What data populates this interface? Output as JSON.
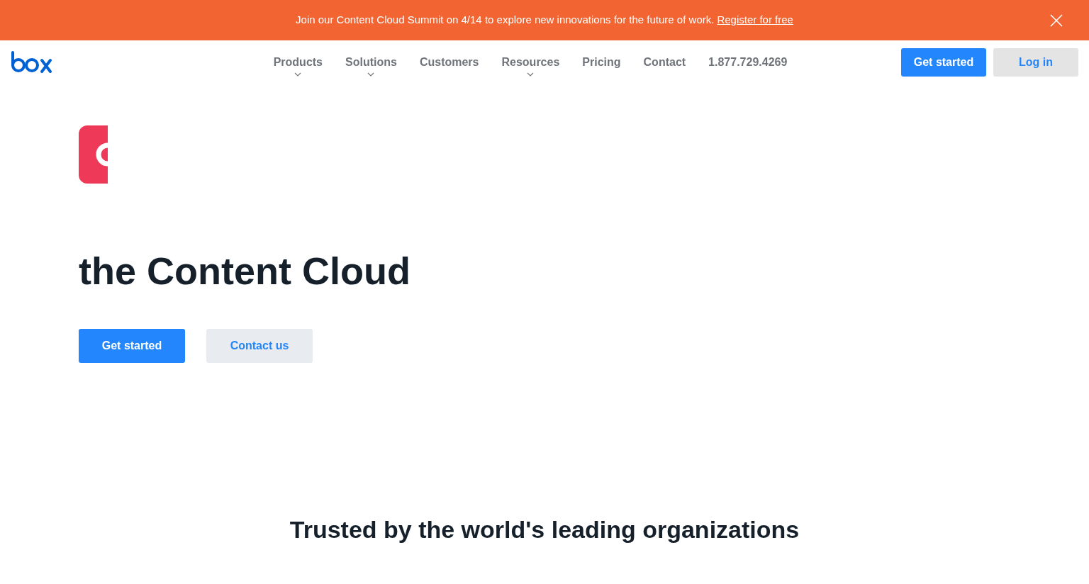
{
  "banner": {
    "text": "Join our Content Cloud Summit on 4/14 to explore new innovations for the future of work.",
    "link": "Register for free"
  },
  "nav": {
    "items": [
      {
        "label": "Products",
        "has_menu": true
      },
      {
        "label": "Solutions",
        "has_menu": true
      },
      {
        "label": "Customers",
        "has_menu": false
      },
      {
        "label": "Resources",
        "has_menu": true
      },
      {
        "label": "Pricing",
        "has_menu": false
      },
      {
        "label": "Contact",
        "has_menu": false
      },
      {
        "label": "1.877.729.4269",
        "has_menu": false
      }
    ],
    "primary_button": "Get started",
    "login_button": "Log in"
  },
  "hero": {
    "title": "the Content Cloud",
    "primary_button": "Get started",
    "secondary_button": "Contact us"
  },
  "trusted": {
    "heading": "Trusted by the world's leading organizations"
  }
}
